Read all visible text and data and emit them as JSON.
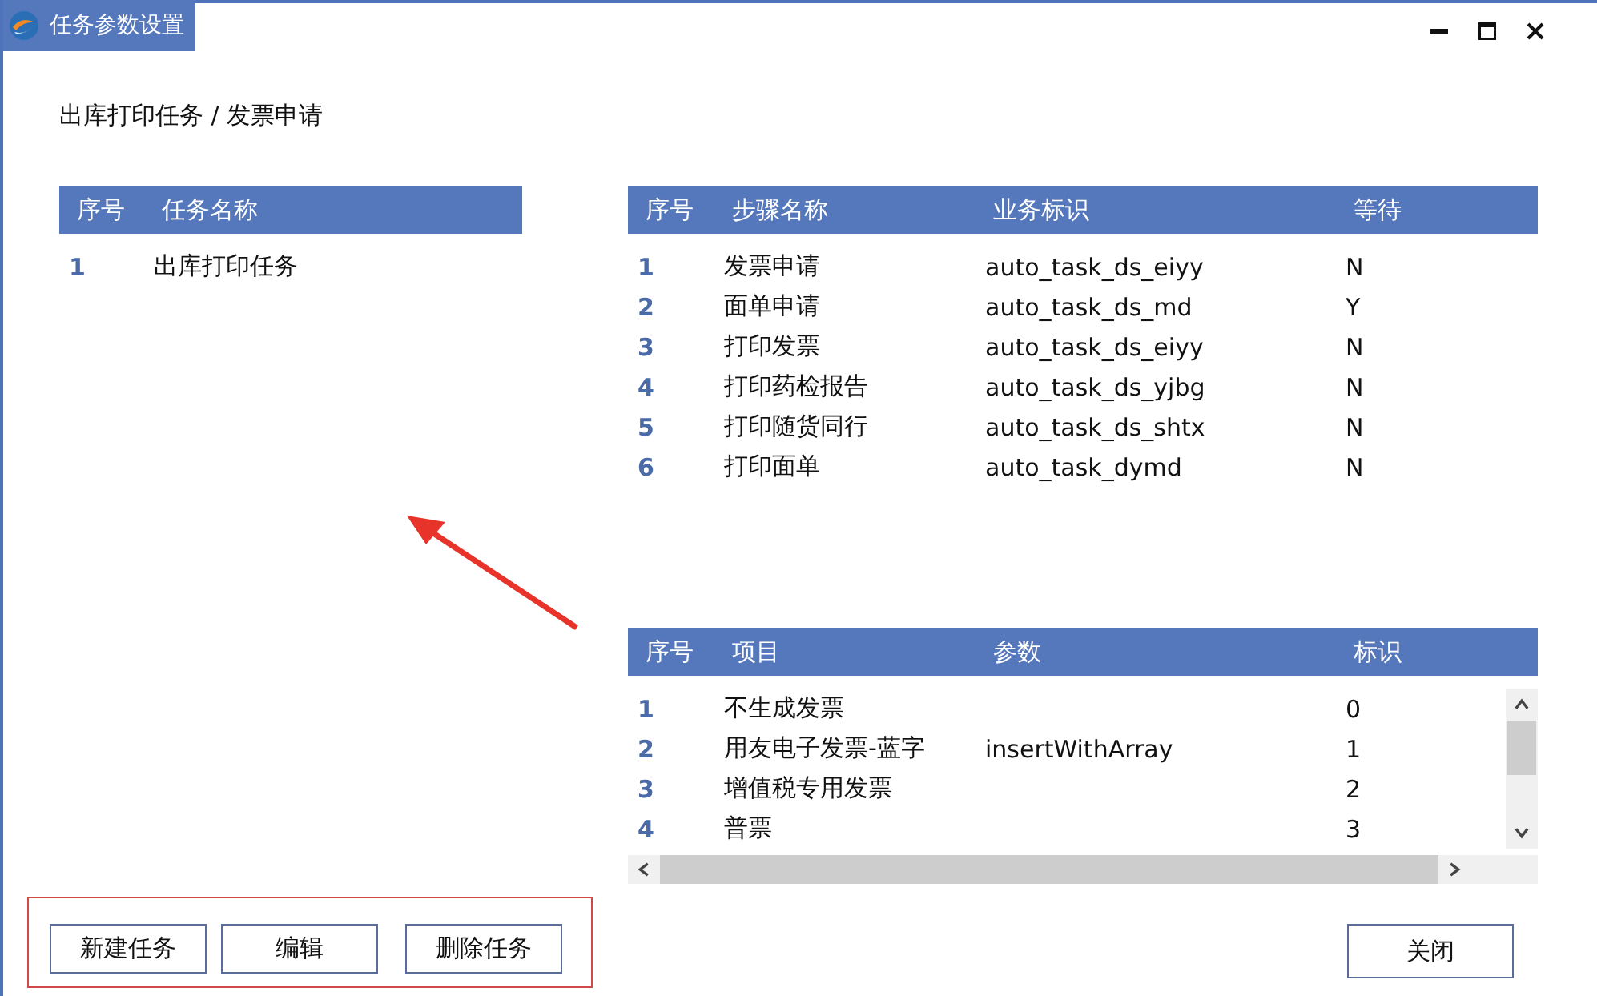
{
  "window": {
    "title": "任务参数设置"
  },
  "breadcrumb": "出库打印任务 / 发票申请",
  "task_table": {
    "columns": [
      "序号",
      "任务名称"
    ],
    "rows": [
      [
        "1",
        "出库打印任务"
      ]
    ]
  },
  "step_table": {
    "columns": [
      "序号",
      "步骤名称",
      "业务标识",
      "等待"
    ],
    "rows": [
      [
        "1",
        "发票申请",
        "auto_task_ds_eiyy",
        "N"
      ],
      [
        "2",
        "面单申请",
        "auto_task_ds_md",
        "Y"
      ],
      [
        "3",
        "打印发票",
        "auto_task_ds_eiyy",
        "N"
      ],
      [
        "4",
        "打印药检报告",
        "auto_task_ds_yjbg",
        "N"
      ],
      [
        "5",
        "打印随货同行",
        "auto_task_ds_shtx",
        "N"
      ],
      [
        "6",
        "打印面单",
        "auto_task_dymd",
        "N"
      ]
    ]
  },
  "param_table": {
    "columns": [
      "序号",
      "项目",
      "参数",
      "标识"
    ],
    "rows": [
      [
        "1",
        "不生成发票",
        "",
        "0"
      ],
      [
        "2",
        "用友电子发票-蓝字",
        "insertWithArray",
        "1"
      ],
      [
        "3",
        "增值税专用发票",
        "",
        "2"
      ],
      [
        "4",
        "普票",
        "",
        "3"
      ]
    ]
  },
  "buttons": [
    "新建任务",
    "编辑",
    "删除任务"
  ],
  "close_button": "关闭"
}
